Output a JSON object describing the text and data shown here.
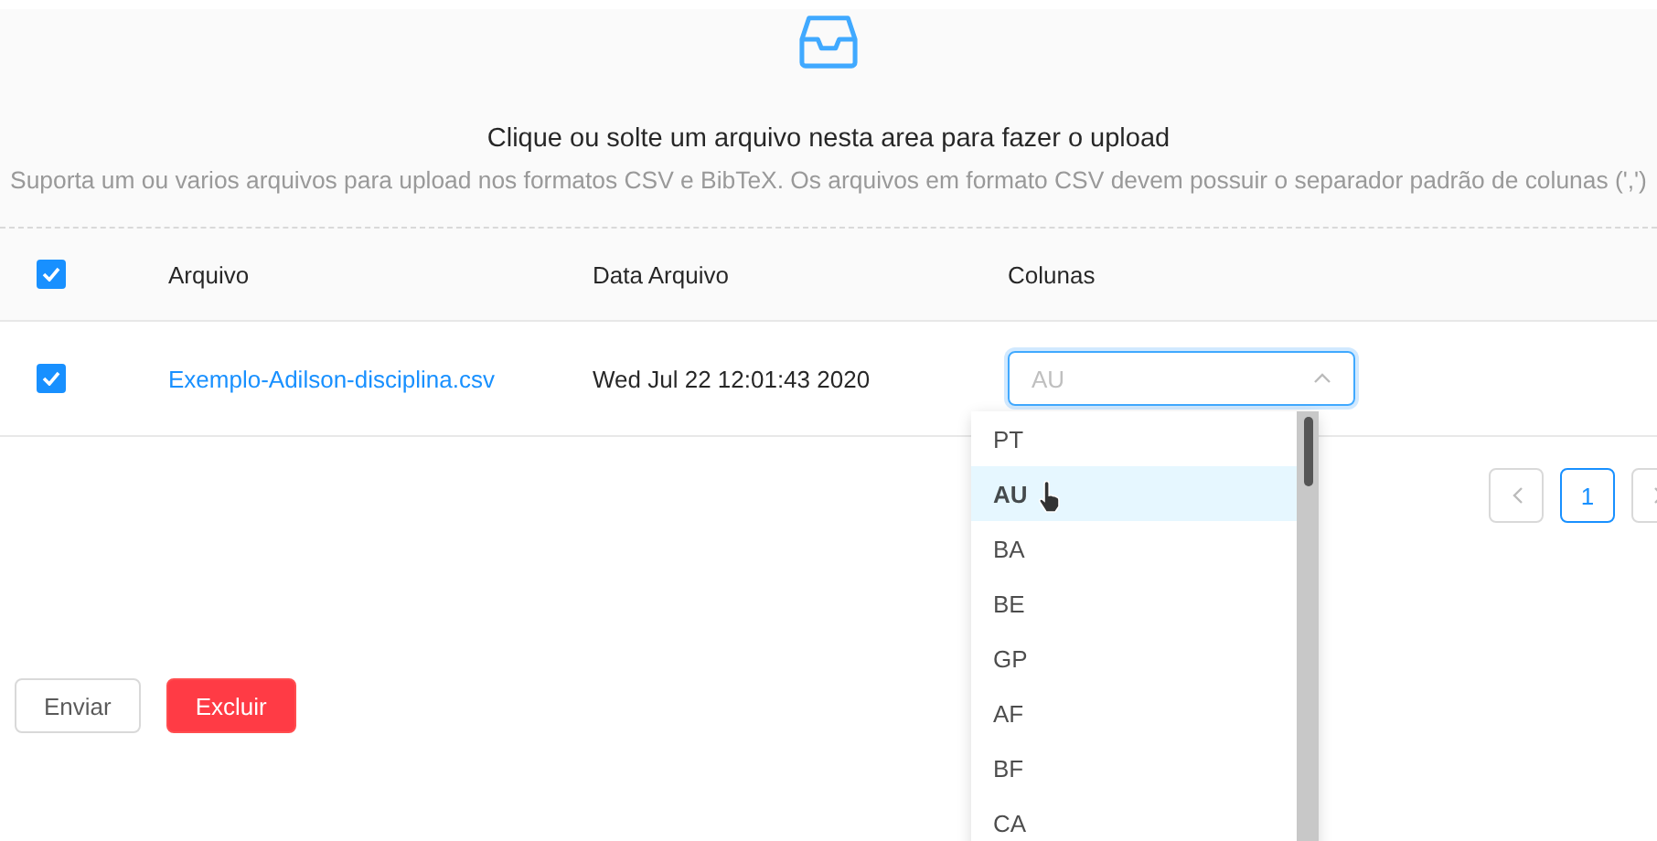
{
  "upload": {
    "title": "Clique ou solte um arquivo nesta area para fazer o upload",
    "hint": "Suporta um ou varios arquivos para upload nos formatos CSV e BibTeX. Os arquivos em formato CSV devem possuir o separador padrão de colunas (',')"
  },
  "table": {
    "select_all_checked": true,
    "columns": [
      "Arquivo",
      "Data Arquivo",
      "Colunas"
    ],
    "rows": [
      {
        "checked": true,
        "file": "Exemplo-Adilson-disciplina.csv",
        "date": "Wed Jul 22 12:01:43 2020",
        "column_select": {
          "placeholder": "AU",
          "expanded": true
        }
      }
    ]
  },
  "dropdown": {
    "options": [
      {
        "label": "PT",
        "selected": false
      },
      {
        "label": "AU",
        "selected": true
      },
      {
        "label": "BA",
        "selected": false
      },
      {
        "label": "BE",
        "selected": false
      },
      {
        "label": "GP",
        "selected": false
      },
      {
        "label": "AF",
        "selected": false
      },
      {
        "label": "BF",
        "selected": false
      },
      {
        "label": "CA",
        "selected": false
      }
    ]
  },
  "pagination": {
    "pages": [
      {
        "label": "1",
        "selected": true
      }
    ]
  },
  "buttons": [
    {
      "label": "Enviar",
      "kind": "default"
    },
    {
      "label": "Excluir",
      "kind": "danger"
    }
  ]
}
